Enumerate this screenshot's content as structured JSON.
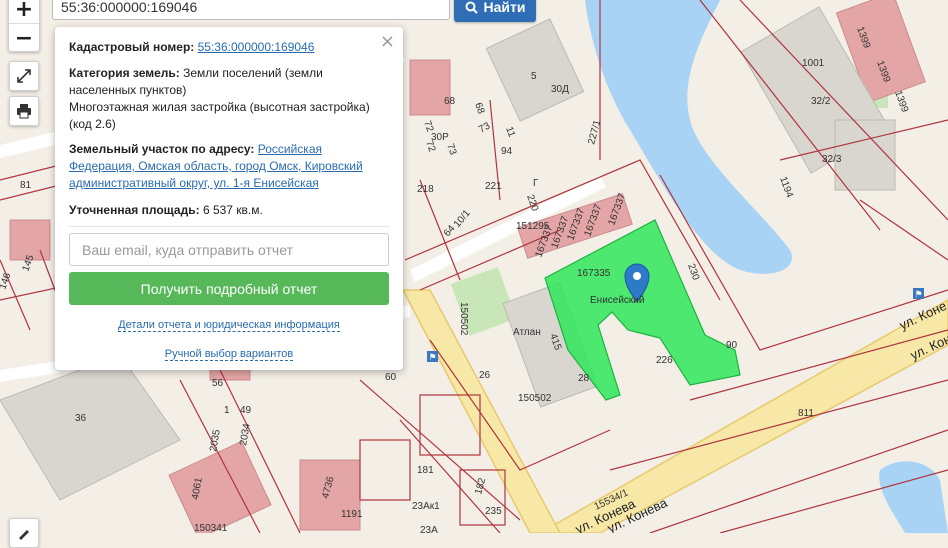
{
  "search": {
    "value": "55:36:000000:169046",
    "button_label": "Найти"
  },
  "zoom": {
    "in_label": "+",
    "out_label": "−"
  },
  "popup": {
    "cadastral_label": "Кадастровый номер:",
    "cadastral_value": "55:36:000000:169046",
    "category_label": "Категория земель:",
    "category_value": "Земли поселений (земли населенных пунктов)",
    "use_value": "Многоэтажная жилая застройка (высотная застройка) (код 2.6)",
    "address_label": "Земельный участок по адресу:",
    "address_value": "Российская Федерация, Омская область, город Омск, Кировский административный округ, ул. 1-я Енисейская",
    "area_label": "Уточненная площадь:",
    "area_value": "6 537 кв.м.",
    "email_placeholder": "Ваш email, куда отправить отчет",
    "report_button": "Получить подробный отчет",
    "details_link": "Детали отчета и юридическая информация",
    "manual_link": "Ручной выбор вариантов",
    "close_label": "×"
  },
  "map_labels": [
    "30Д",
    "5",
    "1001",
    "32/2",
    "32/3",
    "1399",
    "1399",
    "1399",
    "1194",
    "227/1",
    "68",
    "68",
    "72",
    "72",
    "30Р",
    "73",
    "73",
    "11",
    "94",
    "81",
    "218",
    "221",
    "220",
    "Г",
    "151295",
    "167337",
    "167337",
    "167337",
    "167335",
    "167337",
    "167337",
    "64",
    "10/1",
    "230",
    "145",
    "146",
    "150502",
    "415",
    "Атлан",
    "Енисейский",
    "226",
    "90",
    "28",
    "26",
    "150502",
    "60",
    "56",
    "1",
    "49",
    "36",
    "2035",
    "2034",
    "811",
    "181",
    "4736",
    "1191",
    "4061",
    "150341",
    "23Ак1",
    "23А",
    "182",
    "235",
    "15534/1",
    "ул. Конева",
    "ул. Конева",
    "ул. Коне",
    "ул. Коне"
  ],
  "colors": {
    "parcel_fill": "#2ee65a",
    "boundary": "#b0343d",
    "water": "#a9d3f5",
    "road": "#f7e8a8",
    "building": "#e3a5a5",
    "marker": "#2c7ac8"
  }
}
